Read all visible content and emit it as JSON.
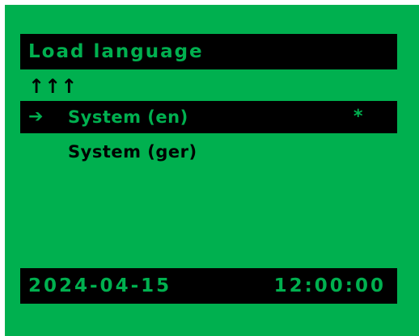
{
  "colors": {
    "screen_background": "#00b04f",
    "bar_background": "#000000",
    "highlight_text": "#00b04f",
    "normal_text": "#000000"
  },
  "header": {
    "title": "Load language"
  },
  "navigation": {
    "up_arrows": "↑↑↑",
    "icon": "up-arrows-icon"
  },
  "menu": {
    "pointer": "➔",
    "pointer_icon": "arrow-right-icon",
    "items": [
      {
        "label": "System (en)",
        "selected": true,
        "marker": "*"
      },
      {
        "label": "System (ger)",
        "selected": false,
        "marker": ""
      }
    ]
  },
  "status": {
    "date": "2024-04-15",
    "time": "12:00:00"
  }
}
